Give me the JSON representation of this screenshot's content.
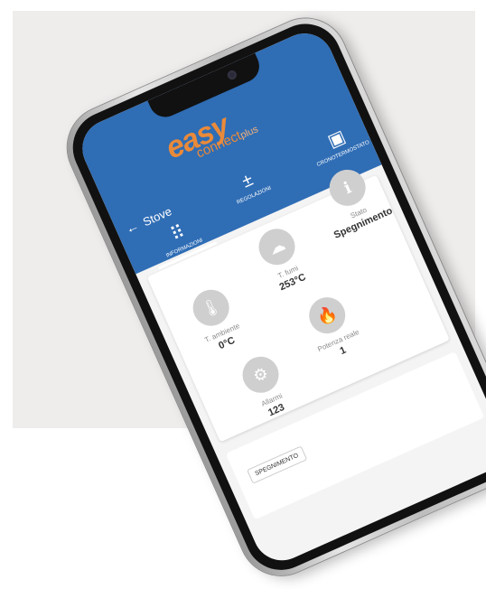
{
  "app": {
    "logo_main": "easy",
    "logo_sub": "connect",
    "logo_plus": "plus"
  },
  "nav": {
    "back_label": "Stove",
    "tabs": [
      {
        "label": "Informazioni",
        "icon": "grid-icon"
      },
      {
        "label": "Regolazioni",
        "icon": "plus-minus-icon"
      },
      {
        "label": "Cronotermostato",
        "icon": "calendar-icon"
      }
    ]
  },
  "info": {
    "ambient": {
      "label": "T. ambiente",
      "value": "0°C",
      "icon": "thermometer-icon"
    },
    "smoke": {
      "label": "T. fumi",
      "value": "253°C",
      "icon": "smoke-icon"
    },
    "state": {
      "label": "Stato",
      "value": "Spegnimento",
      "icon": "info-icon"
    },
    "alarms": {
      "label": "Allarmi",
      "value": "123",
      "icon": "alarm-gear-icon"
    },
    "power": {
      "label": "Potenza reale",
      "value": "1",
      "icon": "flame-icon"
    }
  },
  "status": {
    "chip": "Spegnimento"
  },
  "colors": {
    "header": "#2f6db5",
    "logo": "#e98a3a",
    "circle": "#cfcfcf"
  }
}
